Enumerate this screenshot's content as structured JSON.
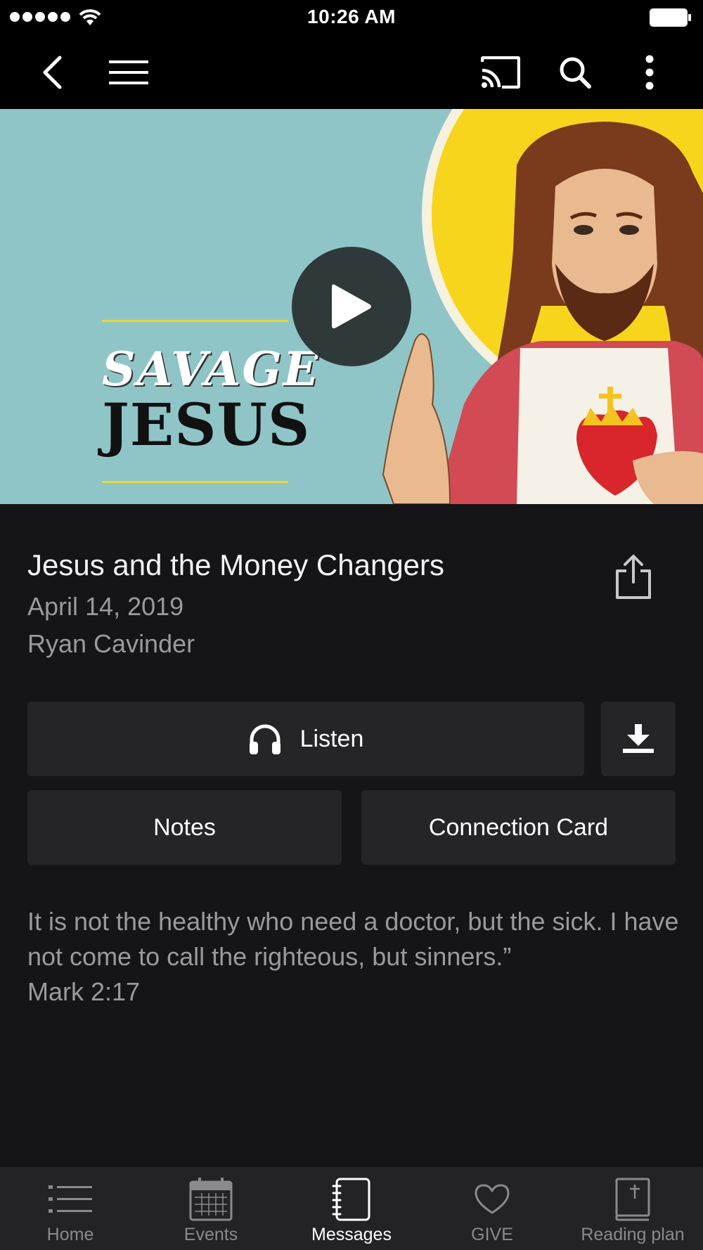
{
  "status_bar": {
    "time": "10:26 AM"
  },
  "nav": {
    "icons": [
      "back-icon",
      "menu-icon",
      "cast-icon",
      "search-icon",
      "more-vertical-icon"
    ]
  },
  "hero": {
    "title_line1": "SAVAGE",
    "title_line2": "JESUS"
  },
  "sermon": {
    "title": "Jesus and the Money Changers",
    "date": "April 14, 2019",
    "speaker": "Ryan Cavinder"
  },
  "actions": {
    "listen_label": "Listen",
    "notes_label": "Notes",
    "connection_card_label": "Connection Card"
  },
  "quote": {
    "text": "It is not the healthy who need a doctor, but the sick. I have not come to call the righteous, but sinners.”",
    "reference": "Mark 2:17"
  },
  "tabs": [
    {
      "label": "Home",
      "icon": "list-icon",
      "active": false
    },
    {
      "label": "Events",
      "icon": "calendar-icon",
      "active": false
    },
    {
      "label": "Messages",
      "icon": "notebook-icon",
      "active": true
    },
    {
      "label": "GIVE",
      "icon": "heart-icon",
      "active": false
    },
    {
      "label": "Reading plan",
      "icon": "bible-icon",
      "active": false
    }
  ],
  "colors": {
    "background": "#151517",
    "button": "#252527",
    "tab_bar": "#232325",
    "muted_text": "#9a9a9c",
    "hero_teal": "#8fc5c7",
    "halo_yellow": "#f7d51c"
  }
}
